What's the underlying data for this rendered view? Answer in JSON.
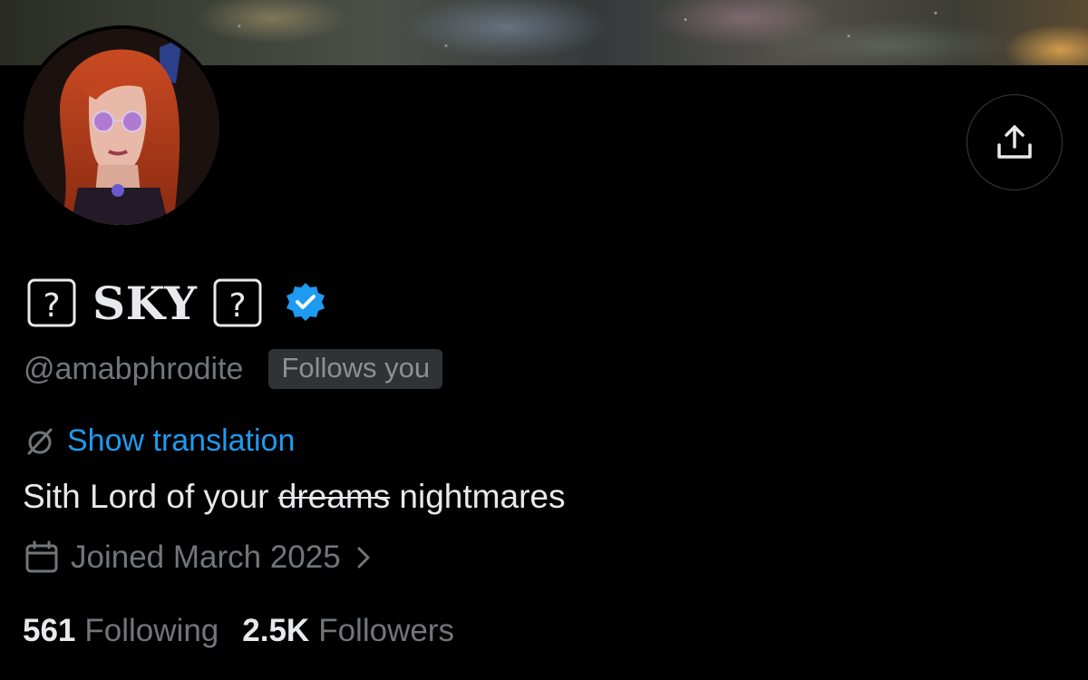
{
  "profile": {
    "name_prefix_glyph": "?",
    "name": "SKY",
    "name_suffix_glyph": "?",
    "verified": true,
    "handle": "@amabphrodite",
    "follows_you_badge": "Follows you",
    "show_translation": "Show translation",
    "bio_before": "Sith Lord of your ",
    "bio_struck": "dreams",
    "bio_after": " nightmares",
    "joined": "Joined March 2025",
    "following_count": "561",
    "following_label": "Following",
    "followers_count": "2.5K",
    "followers_label": "Followers"
  },
  "icons": {
    "share": "share-upload-icon",
    "verified": "verified-badge-icon",
    "translate": "translate-slash-icon",
    "calendar": "calendar-icon",
    "chevron": "chevron-right-icon"
  },
  "colors": {
    "background": "#000000",
    "text_primary": "#e7e9ea",
    "text_secondary": "#71767b",
    "link_blue": "#1d9bf0",
    "badge_bg": "#2f3336"
  }
}
